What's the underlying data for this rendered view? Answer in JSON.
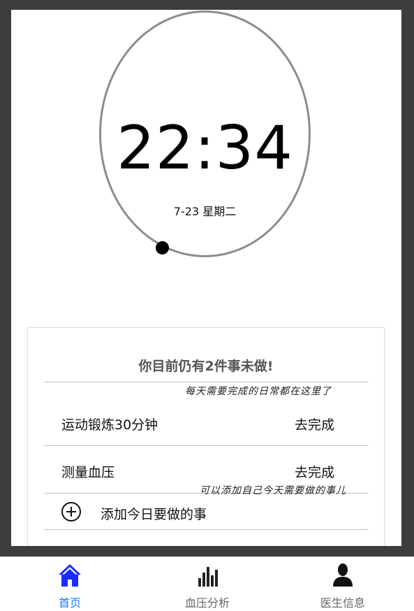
{
  "clock": {
    "time": "22:34",
    "date": "7-23 星期二"
  },
  "todo": {
    "header": "你目前仍有2件事未做!",
    "annotation_daily": "每天需要完成的日常都在这里了",
    "annotation_add": "可以添加自己今天需要做的事儿",
    "tasks": [
      {
        "name": "运动锻炼30分钟",
        "action": "去完成"
      },
      {
        "name": "测量血压",
        "action": "去完成"
      }
    ],
    "add_label": "添加今日要做的事"
  },
  "nav": {
    "items": [
      {
        "label": "首页",
        "icon": "home-icon",
        "active": true
      },
      {
        "label": "血压分析",
        "icon": "bar-chart-icon",
        "active": false
      },
      {
        "label": "医生信息",
        "icon": "user-icon",
        "active": false
      }
    ],
    "active_color": "#1a2bff",
    "inactive_color": "#666666"
  }
}
